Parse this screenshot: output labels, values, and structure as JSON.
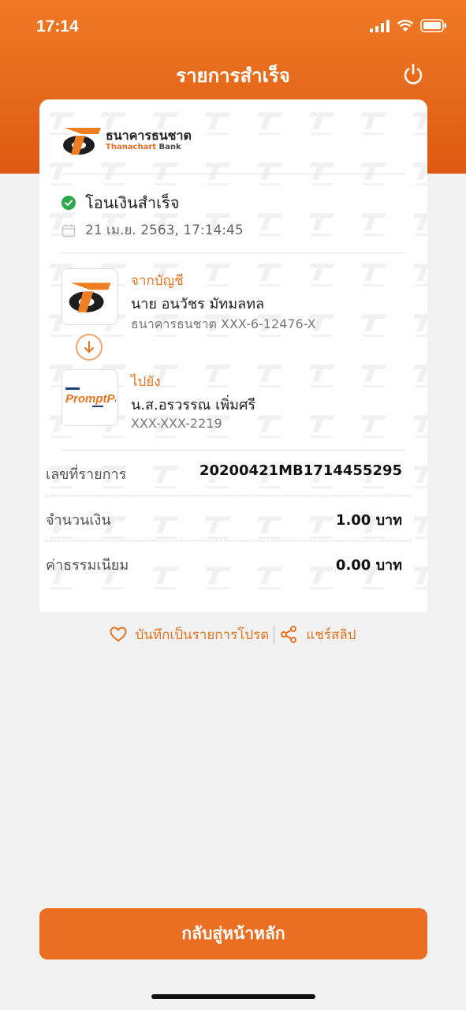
{
  "status_bar": {
    "time": "17:14"
  },
  "header": {
    "title": "รายการสำเร็จ"
  },
  "bank": {
    "name_th": "ธนาคารธนชาต",
    "name_en_1": "Thanachart",
    "name_en_2": "Bank"
  },
  "status": {
    "message": "โอนเงินสำเร็จ",
    "datetime": "21 เม.ย. 2563, 17:14:45"
  },
  "from": {
    "label": "จากบัญชี",
    "name": "นาย อนวัชร มัทมลทล",
    "account": "ธนาคารธนชาต XXX-6-12476-X"
  },
  "to": {
    "label": "ไปยัง",
    "name": "น.ส.อรวรรณ เพิ่มศรี",
    "account": "XXX-XXX-2219",
    "logo_text": "PromptPay"
  },
  "details": [
    {
      "label": "เลขที่รายการ",
      "value": "20200421MB1714455295"
    },
    {
      "label": "จำนวนเงิน",
      "value": "1.00 บาท"
    },
    {
      "label": "ค่าธรรมเนียม",
      "value": "0.00 บาท"
    }
  ],
  "actions": {
    "favorite": "บันทึกเป็นรายการโปรด",
    "share": "แชร์สลิป"
  },
  "button": {
    "home": "กลับสู่หน้าหลัก"
  },
  "colors": {
    "brand": "#ea6f22",
    "success": "#2aa84a"
  }
}
